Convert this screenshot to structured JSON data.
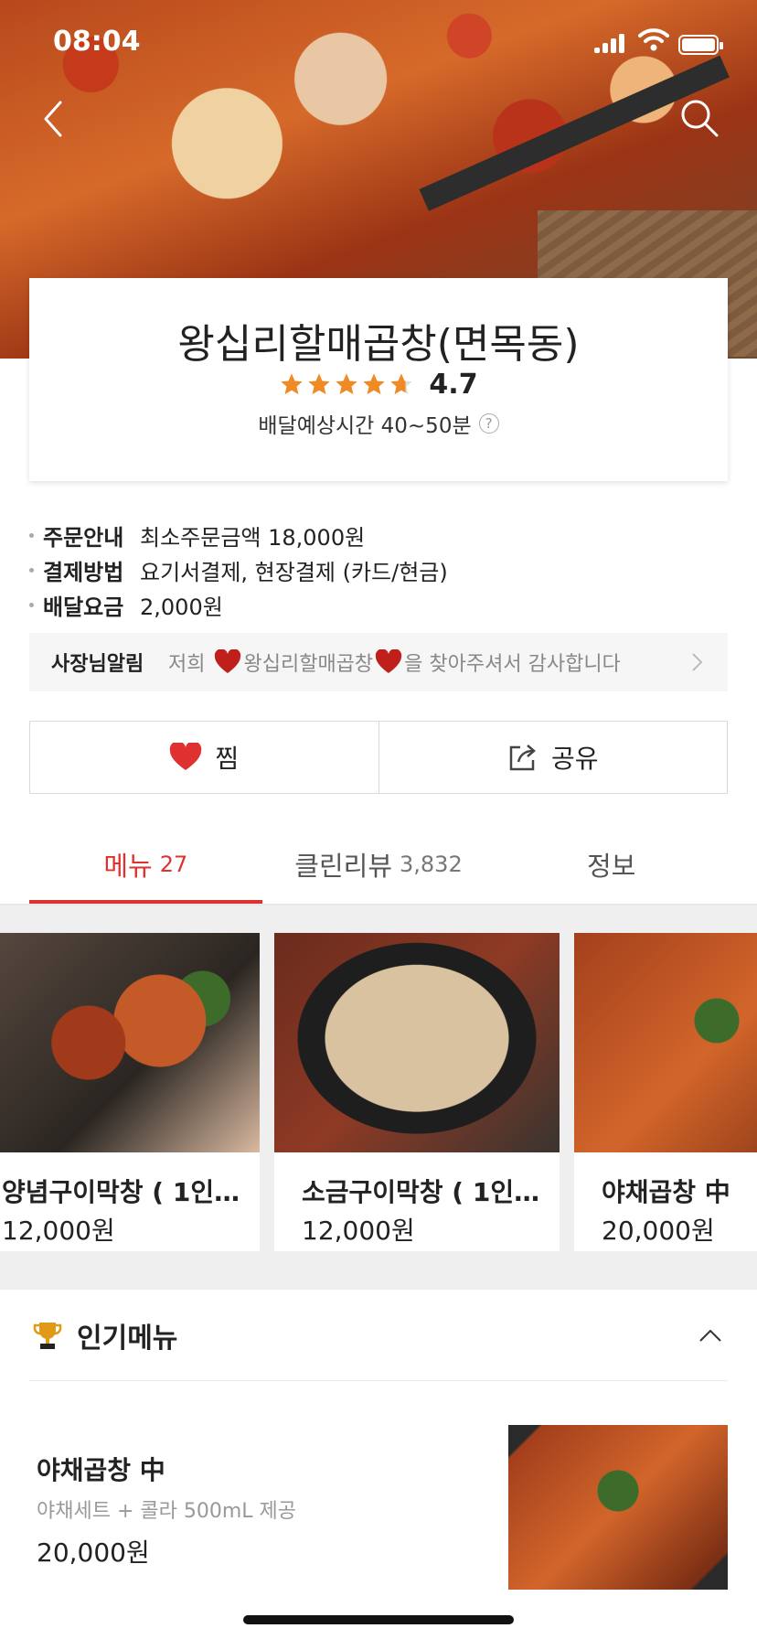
{
  "status_bar": {
    "time": "08:04"
  },
  "store": {
    "name": "왕십리할매곱창(면목동)",
    "rating": "4.7",
    "rating_value": 4.7,
    "delivery_time": "배달예상시간 40~50분",
    "help": "?"
  },
  "info": {
    "rows": [
      {
        "label": "주문안내",
        "value": "최소주문금액 18,000원"
      },
      {
        "label": "결제방법",
        "value": "요기서결제, 현장결제 (카드/현금)"
      },
      {
        "label": "배달요금",
        "value": "2,000원"
      }
    ]
  },
  "notice": {
    "label": "사장님알림",
    "prefix": "저희",
    "store": "왕십리할매곱창",
    "suffix": "을 찾아주셔서 감사합니다"
  },
  "actions": {
    "favorite_label": "찜",
    "share_label": "공유"
  },
  "tabs": [
    {
      "label": "메뉴",
      "count": "27"
    },
    {
      "label": "클린리뷰",
      "count": "3,832"
    },
    {
      "label": "정보",
      "count": ""
    }
  ],
  "carousel": [
    {
      "name": "양념구이막창 ( 1인…",
      "price": "12,000원"
    },
    {
      "name": "소금구이막창 ( 1인…",
      "price": "12,000원"
    },
    {
      "name": "야채곱창 中",
      "price": "20,000원"
    }
  ],
  "popular": {
    "title": "인기메뉴",
    "items": [
      {
        "name": "야채곱창 中",
        "desc": "야채세트 + 콜라 500mL 제공",
        "price": "20,000원"
      }
    ]
  },
  "colors": {
    "accent": "#e03131",
    "star": "#f08a24"
  },
  "icons": [
    "back-icon",
    "search-icon",
    "star-icon",
    "help-icon",
    "heart-icon",
    "share-icon",
    "chevron-right-icon",
    "trophy-icon",
    "chevron-up-icon"
  ]
}
